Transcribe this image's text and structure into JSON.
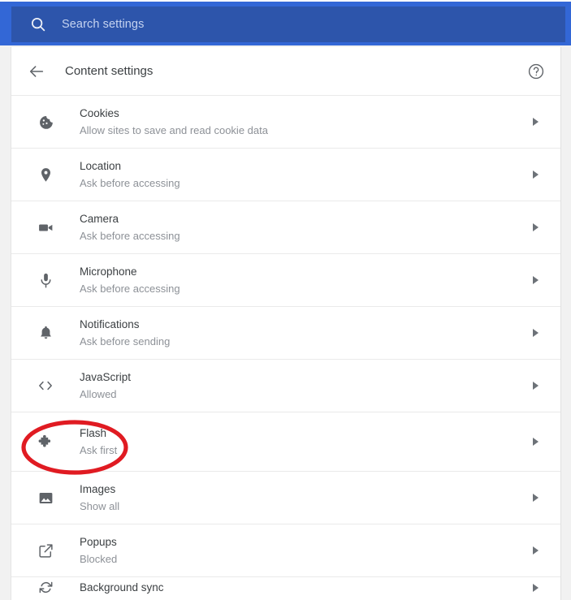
{
  "search": {
    "placeholder": "Search settings",
    "icon": "search-icon",
    "bar_color": "#3367d6",
    "field_color": "#2d55ab"
  },
  "header": {
    "title": "Content settings",
    "back_icon": "arrow-left-icon",
    "help_icon": "help-circle-icon"
  },
  "annotation": {
    "shape": "ellipse",
    "color": "#e01b22",
    "target": "Flash"
  },
  "rows": [
    {
      "icon": "cookie-icon",
      "title": "Cookies",
      "subtitle": "Allow sites to save and read cookie data"
    },
    {
      "icon": "location-pin-icon",
      "title": "Location",
      "subtitle": "Ask before accessing"
    },
    {
      "icon": "camera-icon",
      "title": "Camera",
      "subtitle": "Ask before accessing"
    },
    {
      "icon": "microphone-icon",
      "title": "Microphone",
      "subtitle": "Ask before accessing"
    },
    {
      "icon": "bell-icon",
      "title": "Notifications",
      "subtitle": "Ask before sending"
    },
    {
      "icon": "code-brackets-icon",
      "title": "JavaScript",
      "subtitle": "Allowed"
    },
    {
      "icon": "puzzle-piece-icon",
      "title": "Flash",
      "subtitle": "Ask first"
    },
    {
      "icon": "image-icon",
      "title": "Images",
      "subtitle": "Show all"
    },
    {
      "icon": "popup-window-icon",
      "title": "Popups",
      "subtitle": "Blocked"
    },
    {
      "icon": "sync-icon",
      "title": "Background sync",
      "subtitle": ""
    }
  ]
}
